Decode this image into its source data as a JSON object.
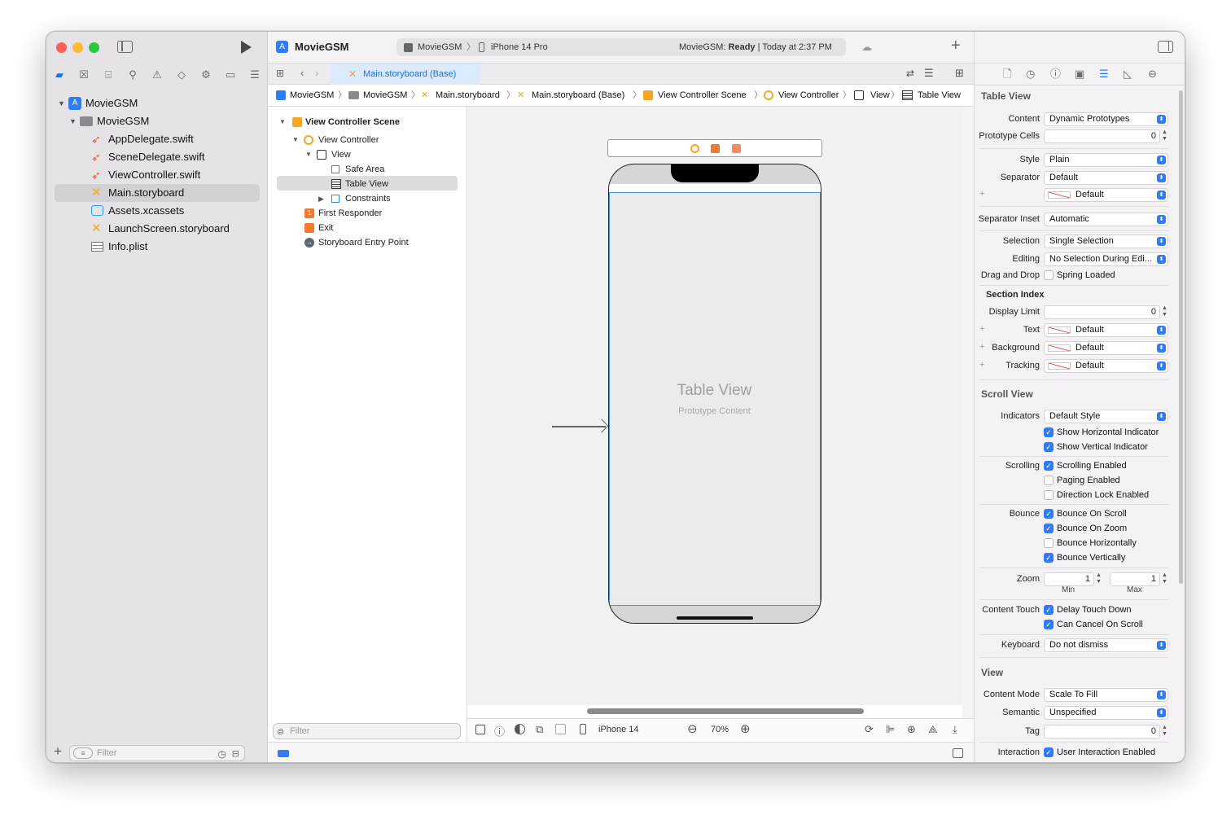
{
  "project": {
    "name": "MovieGSM"
  },
  "toolbar": {
    "scheme": "MovieGSM",
    "device": "iPhone 14 Pro",
    "status_prefix": "MovieGSM: ",
    "status_state": "Ready",
    "status_time": " | Today at 2:37 PM"
  },
  "tabs": [
    {
      "label": "Main.storyboard (Base)"
    }
  ],
  "breadcrumb": [
    "MovieGSM",
    "MovieGSM",
    "Main.storyboard",
    "Main.storyboard (Base)",
    "View Controller Scene",
    "View Controller",
    "View",
    "Table View"
  ],
  "navigator": {
    "items": [
      {
        "label": "MovieGSM"
      },
      {
        "label": "MovieGSM"
      },
      {
        "label": "AppDelegate.swift"
      },
      {
        "label": "SceneDelegate.swift"
      },
      {
        "label": "ViewController.swift"
      },
      {
        "label": "Main.storyboard"
      },
      {
        "label": "Assets.xcassets"
      },
      {
        "label": "LaunchScreen.storyboard"
      },
      {
        "label": "Info.plist"
      }
    ],
    "filter_placeholder": "Filter"
  },
  "outline": {
    "items": [
      {
        "label": "View Controller Scene"
      },
      {
        "label": "View Controller"
      },
      {
        "label": "View"
      },
      {
        "label": "Safe Area"
      },
      {
        "label": "Table View"
      },
      {
        "label": "Constraints"
      },
      {
        "label": "First Responder"
      },
      {
        "label": "Exit"
      },
      {
        "label": "Storyboard Entry Point"
      }
    ],
    "filter_placeholder": "Filter"
  },
  "canvas": {
    "title": "Table View",
    "subtitle": "Prototype Content",
    "device": "iPhone 14",
    "zoom": "70%"
  },
  "inspector": {
    "table_view": {
      "title": "Table View",
      "content_label": "Content",
      "content_value": "Dynamic Prototypes",
      "prototype_label": "Prototype Cells",
      "prototype_value": "0",
      "style_label": "Style",
      "style_value": "Plain",
      "separator_label": "Separator",
      "separator_value": "Default",
      "separator_color": "Default",
      "inset_label": "Separator Inset",
      "inset_value": "Automatic",
      "selection_label": "Selection",
      "selection_value": "Single Selection",
      "editing_label": "Editing",
      "editing_value": "No Selection During Edi...",
      "drag_label": "Drag and Drop",
      "drag_value": "Spring Loaded",
      "section_index": "Section Index",
      "display_limit_label": "Display Limit",
      "display_limit_value": "0",
      "text_label": "Text",
      "text_value": "Default",
      "background_label": "Background",
      "background_value": "Default",
      "tracking_label": "Tracking",
      "tracking_value": "Default"
    },
    "scroll_view": {
      "title": "Scroll View",
      "indicators_label": "Indicators",
      "indicators_value": "Default Style",
      "show_h": "Show Horizontal Indicator",
      "show_v": "Show Vertical Indicator",
      "scrolling_label": "Scrolling",
      "scrolling_enabled": "Scrolling Enabled",
      "paging_enabled": "Paging Enabled",
      "direction_lock": "Direction Lock Enabled",
      "bounce_label": "Bounce",
      "bounce_scroll": "Bounce On Scroll",
      "bounce_zoom": "Bounce On Zoom",
      "bounce_h": "Bounce Horizontally",
      "bounce_v": "Bounce Vertically",
      "zoom_label": "Zoom",
      "zoom_min": "1",
      "zoom_max": "1",
      "min_label": "Min",
      "max_label": "Max",
      "content_touch_label": "Content Touch",
      "delay_touch": "Delay Touch Down",
      "cancel_scroll": "Can Cancel On Scroll",
      "keyboard_label": "Keyboard",
      "keyboard_value": "Do not dismiss"
    },
    "view": {
      "title": "View",
      "content_mode_label": "Content Mode",
      "content_mode_value": "Scale To Fill",
      "semantic_label": "Semantic",
      "semantic_value": "Unspecified",
      "tag_label": "Tag",
      "tag_value": "0",
      "interaction_label": "Interaction",
      "interaction_value": "User Interaction Enabled"
    }
  },
  "colors": {
    "accent": "#2f7cf6",
    "swift": "#f05138",
    "storyboard": "#f5a623"
  }
}
